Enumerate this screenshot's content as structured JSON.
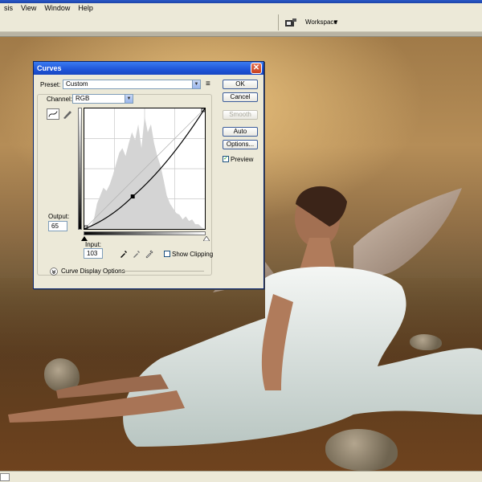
{
  "menu": [
    "sis",
    "View",
    "Window",
    "Help"
  ],
  "options_bar": {
    "workspace_label": "Workspace",
    "workspace_caret": "▼"
  },
  "dialog": {
    "title": "Curves",
    "close_glyph": "✕",
    "preset_label": "Preset:",
    "preset_value": "Custom",
    "preset_menu_glyph": "≡",
    "channel_label": "Channel:",
    "channel_value": "RGB",
    "buttons": {
      "ok": "OK",
      "cancel": "Cancel",
      "smooth": "Smooth",
      "auto": "Auto",
      "options": "Options..."
    },
    "preview": {
      "label": "Preview",
      "checked": true
    },
    "output_label": "Output:",
    "output_value": "65",
    "input_label": "Input:",
    "input_value": "103",
    "show_clipping": {
      "label": "Show Clipping",
      "checked": false
    },
    "display_options_label": "Curve Display Options",
    "display_options_glyph": "»",
    "check_glyph": "✓"
  },
  "colors": {
    "accent": "#1f55d8",
    "close": "#c9421e"
  }
}
